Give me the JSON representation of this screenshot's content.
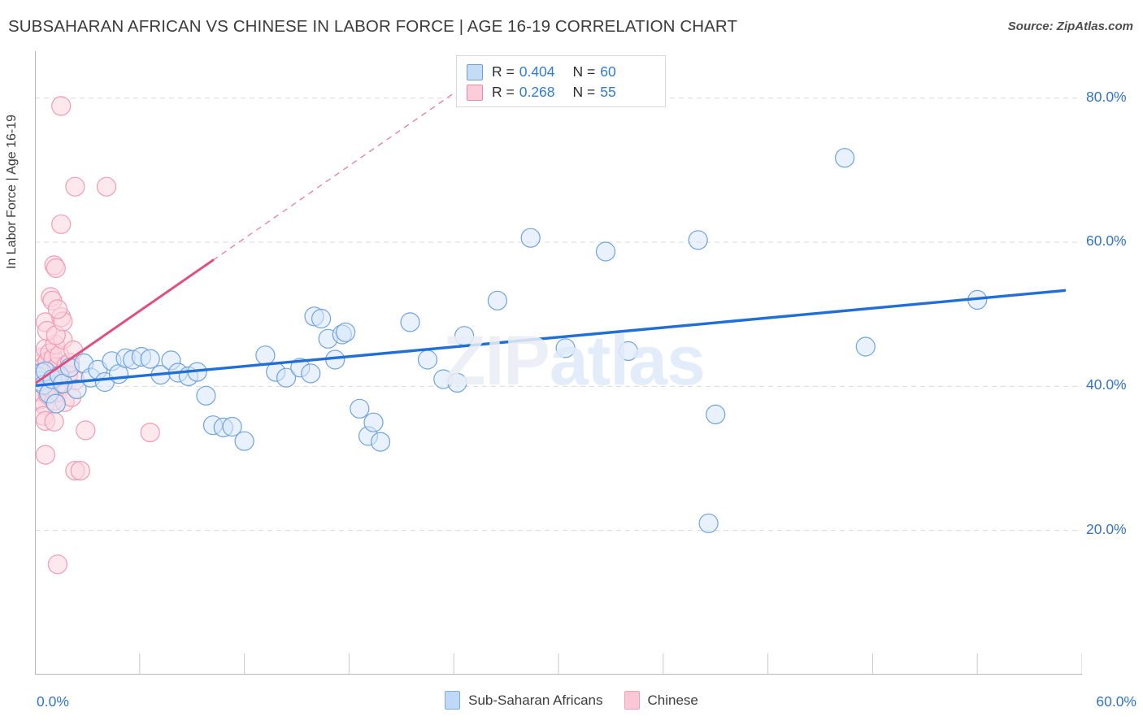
{
  "header": {
    "title": "SUBSAHARAN AFRICAN VS CHINESE IN LABOR FORCE | AGE 16-19 CORRELATION CHART",
    "source": "Source: ZipAtlas.com"
  },
  "watermark": {
    "zip": "ZIP",
    "atlas": "atlas"
  },
  "stats": {
    "rows": [
      {
        "color": "#c5dcf7",
        "r_label": "R = ",
        "r_value": "0.404",
        "n_label": "N = ",
        "n_value": "60"
      },
      {
        "color": "#fbcdda",
        "r_label": "R = ",
        "r_value": "0.268",
        "n_label": "N = ",
        "n_value": "55"
      }
    ]
  },
  "legend": {
    "items": [
      {
        "label": "Sub-Saharan Africans",
        "color": "#bfd8f5"
      },
      {
        "label": "Chinese",
        "color": "#fbc7d6"
      }
    ]
  },
  "colors": {
    "blue_fill": "#d5e6fa",
    "blue_stroke": "#6fa3dd",
    "blue_line": "#1f6fd6",
    "pink_fill": "#fbd5e0",
    "pink_stroke": "#f09cb6",
    "pink_line": "#e04f7e",
    "tick_text": "#3273c8",
    "grid": "#d9d9d9"
  },
  "chart_data": {
    "type": "scatter",
    "title": "SUBSAHARAN AFRICAN VS CHINESE IN LABOR FORCE | AGE 16-19 CORRELATION CHART",
    "xlabel": "",
    "ylabel": "In Labor Force | Age 16-19",
    "xlim": [
      0,
      60
    ],
    "ylim": [
      0,
      86.5
    ],
    "x_tick_labels": [
      "0.0%",
      "60.0%"
    ],
    "y_tick_labels": [
      "20.0%",
      "40.0%",
      "60.0%",
      "80.0%"
    ],
    "y_ticks": [
      20,
      40,
      60,
      80
    ],
    "grid": "horizontal-dashed",
    "legend_position": "bottom-center",
    "series": [
      {
        "name": "Sub-Saharan Africans",
        "color": "#d5e6fa",
        "r": 0.404,
        "n": 60,
        "trendline": {
          "style": "solid",
          "x0": 0.0,
          "y0": 40.1,
          "x1": 59.0,
          "y1": 53.3
        },
        "points": [
          [
            0.2,
            41.3
          ],
          [
            0.3,
            40.7
          ],
          [
            0.4,
            41.9
          ],
          [
            0.5,
            40.2
          ],
          [
            0.6,
            42.1
          ],
          [
            0.8,
            39.0
          ],
          [
            1.0,
            41.0
          ],
          [
            1.2,
            37.6
          ],
          [
            1.4,
            41.5
          ],
          [
            1.6,
            40.4
          ],
          [
            2.0,
            42.6
          ],
          [
            2.4,
            39.6
          ],
          [
            2.8,
            43.2
          ],
          [
            3.2,
            41.2
          ],
          [
            3.6,
            42.3
          ],
          [
            4.0,
            40.6
          ],
          [
            4.4,
            43.5
          ],
          [
            4.8,
            41.7
          ],
          [
            5.2,
            43.9
          ],
          [
            5.6,
            43.7
          ],
          [
            6.1,
            44.1
          ],
          [
            6.6,
            43.8
          ],
          [
            7.2,
            41.6
          ],
          [
            7.8,
            43.6
          ],
          [
            8.2,
            41.9
          ],
          [
            8.8,
            41.4
          ],
          [
            9.3,
            42.0
          ],
          [
            9.8,
            38.7
          ],
          [
            10.2,
            34.6
          ],
          [
            10.8,
            34.3
          ],
          [
            11.3,
            34.4
          ],
          [
            12.0,
            32.4
          ],
          [
            13.2,
            44.3
          ],
          [
            13.8,
            42.0
          ],
          [
            14.4,
            41.2
          ],
          [
            15.2,
            42.6
          ],
          [
            15.8,
            41.8
          ],
          [
            16.0,
            49.7
          ],
          [
            16.4,
            49.4
          ],
          [
            16.8,
            46.6
          ],
          [
            17.2,
            43.7
          ],
          [
            17.6,
            47.2
          ],
          [
            17.8,
            47.5
          ],
          [
            18.6,
            36.9
          ],
          [
            19.1,
            33.1
          ],
          [
            19.4,
            35.0
          ],
          [
            19.8,
            32.3
          ],
          [
            21.5,
            48.9
          ],
          [
            22.5,
            43.7
          ],
          [
            23.4,
            41.0
          ],
          [
            24.2,
            40.5
          ],
          [
            24.6,
            47.0
          ],
          [
            26.5,
            51.9
          ],
          [
            28.4,
            60.6
          ],
          [
            30.4,
            45.3
          ],
          [
            32.7,
            58.7
          ],
          [
            34.0,
            44.9
          ],
          [
            38.0,
            60.3
          ],
          [
            39.0,
            36.1
          ],
          [
            38.6,
            21.0
          ],
          [
            46.4,
            71.7
          ],
          [
            47.6,
            45.5
          ],
          [
            54.0,
            52.0
          ]
        ]
      },
      {
        "name": "Chinese",
        "color": "#fbd5e0",
        "r": 0.268,
        "n": 55,
        "trendline": {
          "style": "solid",
          "x0": 0.0,
          "y0": 40.4,
          "x1": 10.2,
          "y1": 57.5
        },
        "trendline_extension": {
          "style": "dashed",
          "x0": 10.2,
          "y0": 57.5,
          "x1": 24.2,
          "y1": 81.0
        },
        "points": [
          [
            0.1,
            41.4
          ],
          [
            0.15,
            40.6
          ],
          [
            0.2,
            42.3
          ],
          [
            0.25,
            39.3
          ],
          [
            0.3,
            43.1
          ],
          [
            0.35,
            38.2
          ],
          [
            0.4,
            44.0
          ],
          [
            0.45,
            41.0
          ],
          [
            0.5,
            42.8
          ],
          [
            0.55,
            37.4
          ],
          [
            0.6,
            45.2
          ],
          [
            0.65,
            40.0
          ],
          [
            0.7,
            43.4
          ],
          [
            0.75,
            38.8
          ],
          [
            0.8,
            41.8
          ],
          [
            0.85,
            44.6
          ],
          [
            0.9,
            39.8
          ],
          [
            0.95,
            42.2
          ],
          [
            1.0,
            40.9
          ],
          [
            1.05,
            43.9
          ],
          [
            1.1,
            38.0
          ],
          [
            1.15,
            45.8
          ],
          [
            1.2,
            41.1
          ],
          [
            1.25,
            42.7
          ],
          [
            1.3,
            39.2
          ],
          [
            1.4,
            44.3
          ],
          [
            1.5,
            40.3
          ],
          [
            1.6,
            46.5
          ],
          [
            1.7,
            37.8
          ],
          [
            1.8,
            42.9
          ],
          [
            1.9,
            41.6
          ],
          [
            2.0,
            43.3
          ],
          [
            2.1,
            38.5
          ],
          [
            2.2,
            45.0
          ],
          [
            2.3,
            40.8
          ],
          [
            0.6,
            48.9
          ],
          [
            0.7,
            47.7
          ],
          [
            1.2,
            47.1
          ],
          [
            1.5,
            49.6
          ],
          [
            1.6,
            49.0
          ],
          [
            0.9,
            52.4
          ],
          [
            1.0,
            51.9
          ],
          [
            1.3,
            50.7
          ],
          [
            1.1,
            56.8
          ],
          [
            1.2,
            56.4
          ],
          [
            0.5,
            35.9
          ],
          [
            0.6,
            35.2
          ],
          [
            1.1,
            35.1
          ],
          [
            2.9,
            33.9
          ],
          [
            6.6,
            33.6
          ],
          [
            0.6,
            30.5
          ],
          [
            2.3,
            28.3
          ],
          [
            2.6,
            28.3
          ],
          [
            1.3,
            15.3
          ],
          [
            2.3,
            67.7
          ],
          [
            4.1,
            67.7
          ],
          [
            1.5,
            78.9
          ],
          [
            1.5,
            62.5
          ]
        ]
      }
    ]
  }
}
